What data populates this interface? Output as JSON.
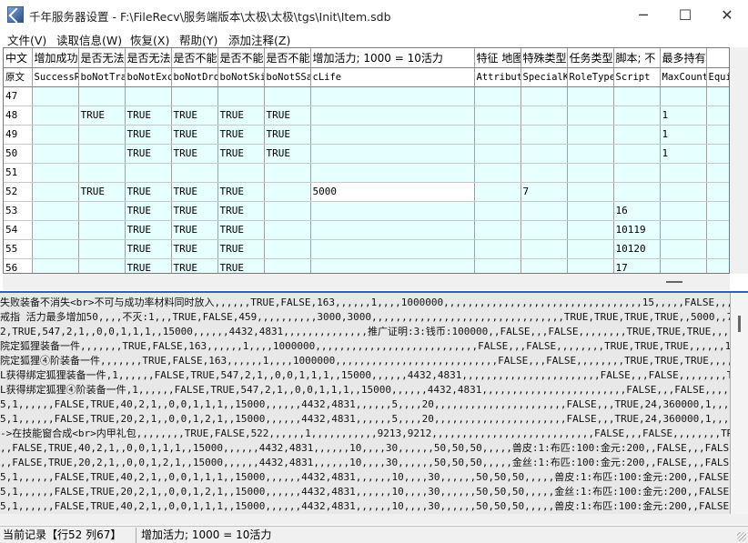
{
  "window": {
    "title": "千年服务器设置 - F:\\FileRecv\\服务端版本\\太极\\太极\\tgs\\Init\\Item.sdb",
    "minimize": "─",
    "maximize": "☐",
    "close": "✕"
  },
  "menu": [
    "文件(V)",
    "读取信息(W)",
    "恢复(X)",
    "帮助(Y)",
    "添加注释(Z)"
  ],
  "grid": {
    "header_cn_label": "中文",
    "header_orig_label": "原文",
    "header_cn": [
      "增加成功",
      "是否无法",
      "是否无法",
      "是否不能",
      "是否不能",
      "是否不能",
      "增加活力; 1000 = 10活力",
      "特征 地图",
      "特殊类型",
      "任务类型",
      "脚本; 不",
      "最多持有",
      ""
    ],
    "header_orig": [
      "SuccessR",
      "boNotTra",
      "boNotExc",
      "boNotDro",
      "boNotSki",
      "boNotSSa",
      "cLife",
      "Attribut",
      "SpecialK",
      "RoleType",
      "Script",
      "MaxCount",
      "Equi"
    ],
    "rows": [
      {
        "id": "47",
        "cells": [
          "",
          "",
          "",
          "",
          "",
          "",
          "",
          "",
          "",
          "",
          "",
          "",
          ""
        ]
      },
      {
        "id": "48",
        "cells": [
          "",
          "TRUE",
          "TRUE",
          "TRUE",
          "TRUE",
          "TRUE",
          "",
          "",
          "",
          "",
          "",
          "1",
          ""
        ]
      },
      {
        "id": "49",
        "cells": [
          "",
          "",
          "TRUE",
          "TRUE",
          "TRUE",
          "TRUE",
          "",
          "",
          "",
          "",
          "",
          "1",
          ""
        ]
      },
      {
        "id": "50",
        "cells": [
          "",
          "",
          "TRUE",
          "TRUE",
          "TRUE",
          "TRUE",
          "",
          "",
          "",
          "",
          "",
          "1",
          ""
        ]
      },
      {
        "id": "51",
        "cells": [
          "",
          "",
          "",
          "",
          "",
          "",
          "",
          "",
          "",
          "",
          "",
          "",
          ""
        ]
      },
      {
        "id": "52",
        "cells": [
          "",
          "TRUE",
          "TRUE",
          "TRUE",
          "TRUE",
          "",
          "5000",
          "",
          "7",
          "",
          "",
          "",
          ""
        ]
      },
      {
        "id": "53",
        "cells": [
          "",
          "",
          "TRUE",
          "TRUE",
          "TRUE",
          "",
          "",
          "",
          "",
          "",
          "16",
          "",
          ""
        ]
      },
      {
        "id": "54",
        "cells": [
          "",
          "",
          "TRUE",
          "TRUE",
          "TRUE",
          "",
          "",
          "",
          "",
          "",
          "10119",
          "",
          ""
        ]
      },
      {
        "id": "55",
        "cells": [
          "",
          "",
          "TRUE",
          "TRUE",
          "TRUE",
          "",
          "",
          "",
          "",
          "",
          "10120",
          "",
          ""
        ]
      },
      {
        "id": "56",
        "cells": [
          "",
          "",
          "TRUE",
          "TRUE",
          "TRUE",
          "",
          "",
          "",
          "",
          "",
          "17",
          "",
          ""
        ]
      }
    ]
  },
  "text_lines": [
    "失败装备不消失<br>不可与成功率材料同时放入,,,,,,TRUE,FALSE,163,,,,,,1,,,,1000000,,,,,,,,,,,,,,,,,,,,,,,,,,,,,,,,,15,,,,,FALSE,,,FALSE,,,,,,,,,,,,,,,,,",
    "戒指 活力最多增加50,,,,不灭:1,,,TRUE,FALSE,459,,,,,,,,,,3000,3000,,,,,,,,,,,,,,,,,,,,,,,,,,,,,,,,TRUE,TRUE,TRUE,TRUE,,5000,,7,,,,,",
    "2,TRUE,547,2,1,,0,0,1,1,1,,15000,,,,,,4432,4831,,,,,,,,,,,,,,推广证明:3:钱币:100000,,FALSE,,,FALSE,,,,,,,,TRUE,TRUE,TRUE,,,,,,10",
    "院定狐狸装备一件,,,,,,,TRUE,FALSE,163,,,,,,1,,,,1000000,,,,,,,,,,,,,,,,,,,,,,,,,,,FALSE,,,FALSE,,,,,,,,TRUE,TRUE,TRUE,,,,,,10119,,,,,",
    "院定狐狸④阶装备一件,,,,,,,TRUE,FALSE,163,,,,,,1,,,,1000000,,,,,,,,,,,,,,,,,,,,,,,,,,,FALSE,,,FALSE,,,,,,,,TRUE,TRUE,TRUE,,,,,,10120,",
    "L获得绑定狐狸装备一件,1,,,,,,FALSE,TRUE,547,2,1,,0,0,1,1,1,,15000,,,,,,4432,4831,,,,,,,,,,,,,,,,,,,,,,,FALSE,,,FALSE,,,,,,,,TRUE,TRUE,TRUE,",
    "L获得绑定狐狸④阶装备一件,1,,,,,,FALSE,TRUE,547,2,1,,0,0,1,1,1,,15000,,,,,,4432,4831,,,,,,,,,,,,,,,,,,,,,,,,FALSE,,,FALSE,,,,,,,,TRUE,T",
    "5,1,,,,,,FALSE,TRUE,40,2,1,,0,0,1,1,1,,15000,,,,,,4432,4831,,,,,,5,,,,20,,,,,,,,,,,,,,,,,,,,,,FALSE,,,TRUE,24,360000,1,,,,TRUE,TRUE,TRUE,TRUE,",
    "5,1,,,,,,FALSE,TRUE,20,2,1,,0,0,1,2,1,,15000,,,,,,4432,4831,,,,,,5,,,,20,,,,,,,,,,,,,,,,,,,,,,FALSE,,,TRUE,24,360000,1,,,,TRUE,TRUE,TRUE,TRUE,",
    "->在技能窗合成<br>内甲礼包,,,,,,,,TRUE,FALSE,522,,,,,,1,,,,,,,,,,,9213,9212,,,,,,,,,,,,,,,,,,,,,,,,,,,FALSE,,,FALSE,,,,,,,,TRUE,TRUE,TRUE,,,,,",
    ",,FALSE,TRUE,40,2,1,,0,0,1,1,1,,15000,,,,,,4432,4831,,,,,,10,,,,30,,,,,,50,50,50,,,,,兽皮:1:布匹:100:金元:200,,FALSE,,,FALSE,,,,,,,,,,,,",
    ",,FALSE,TRUE,20,2,1,,0,0,1,2,1,,15000,,,,,,4432,4831,,,,,,10,,,,30,,,,,,50,50,50,,,,,金丝:1:布匹:100:金元:200,,FALSE,,,FALSE,,,,,,,,,,,,",
    "5,1,,,,,,FALSE,TRUE,40,2,1,,0,0,1,1,1,,15000,,,,,,4432,4831,,,,,,10,,,,30,,,,,,50,50,50,,,,,兽皮:1:布匹:100:金元:200,,FALSE,,,FALSE,,,,,",
    "5,1,,,,,,FALSE,TRUE,20,2,1,,0,0,1,2,1,,15000,,,,,,4432,4831,,,,,,10,,,,30,,,,,,50,50,50,,,,,金丝:1:布匹:100:金元:200,,FALSE,,,FALSE,,,,,",
    "5,1,,,,,,FALSE,TRUE,40,2,1,,0,0,1,1,1,,15000,,,,,,4432,4831,,,,,,10,,,,30,,,,,,50,50,50,,,,,兽皮:1:布匹:100:金元:200,,FALSE,,,FALSE,,,,,"
  ],
  "status": {
    "record": "当前记录【行52  列67】",
    "description": "增加活力; 1000 = 10活力"
  }
}
